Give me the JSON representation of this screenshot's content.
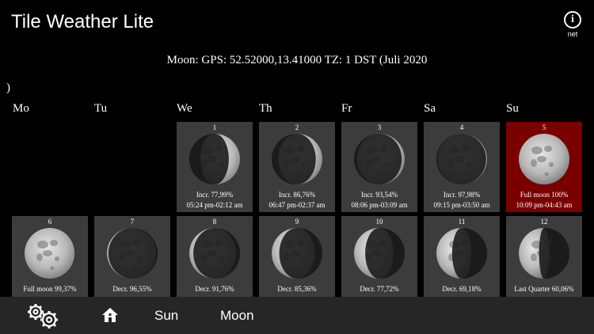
{
  "app": {
    "title": "Tile Weather Lite",
    "info_label": "net"
  },
  "header": {
    "text": "Moon: GPS: 52.52000,13.41000 TZ: 1 DST (Juli 2020",
    "continuation": ")"
  },
  "weekdays": [
    "Mo",
    "Tu",
    "We",
    "Th",
    "Fr",
    "Sa",
    "Su"
  ],
  "days": [
    {
      "day": "1",
      "phase": "Incr. 77,99%",
      "times": "05:24 pm-02:12 am",
      "illumination": 0.78,
      "trend": "waxing"
    },
    {
      "day": "2",
      "phase": "Incr. 86,76%",
      "times": "06:47 pm-02:37 am",
      "illumination": 0.87,
      "trend": "waxing"
    },
    {
      "day": "3",
      "phase": "Incr. 93,54%",
      "times": "08:06 pm-03:09 am",
      "illumination": 0.94,
      "trend": "waxing"
    },
    {
      "day": "4",
      "phase": "Incr. 97,98%",
      "times": "09:15 pm-03:50 am",
      "illumination": 0.98,
      "trend": "waxing"
    },
    {
      "day": "5",
      "phase": "Full moon 100%",
      "times": "10:09 pm-04:43 am",
      "illumination": 1.0,
      "trend": "waxing",
      "highlight": true
    },
    {
      "day": "6",
      "phase": "Full moon 99,37%",
      "times": "",
      "illumination": 0.99,
      "trend": "waning"
    },
    {
      "day": "7",
      "phase": "Decr. 96,55%",
      "times": "",
      "illumination": 0.97,
      "trend": "waning"
    },
    {
      "day": "8",
      "phase": "Decr. 91,76%",
      "times": "",
      "illumination": 0.92,
      "trend": "waning"
    },
    {
      "day": "9",
      "phase": "Decr. 85,36%",
      "times": "",
      "illumination": 0.85,
      "trend": "waning"
    },
    {
      "day": "10",
      "phase": "Decr. 77,72%",
      "times": "",
      "illumination": 0.78,
      "trend": "waning"
    },
    {
      "day": "11",
      "phase": "Decr. 69,18%",
      "times": "",
      "illumination": 0.69,
      "trend": "waning"
    },
    {
      "day": "12",
      "phase": "Last Quarter 60,06%",
      "times": "",
      "illumination": 0.6,
      "trend": "waning"
    }
  ],
  "toolbar": {
    "sun_label": "Sun",
    "moon_label": "Moon"
  },
  "icons": {
    "settings": "gears-icon",
    "home": "home-icon",
    "info": "info-icon"
  },
  "colors": {
    "background": "#000000",
    "tile": "#3c3c3c",
    "highlight": "#7a0000",
    "toolbar": "#262626"
  }
}
